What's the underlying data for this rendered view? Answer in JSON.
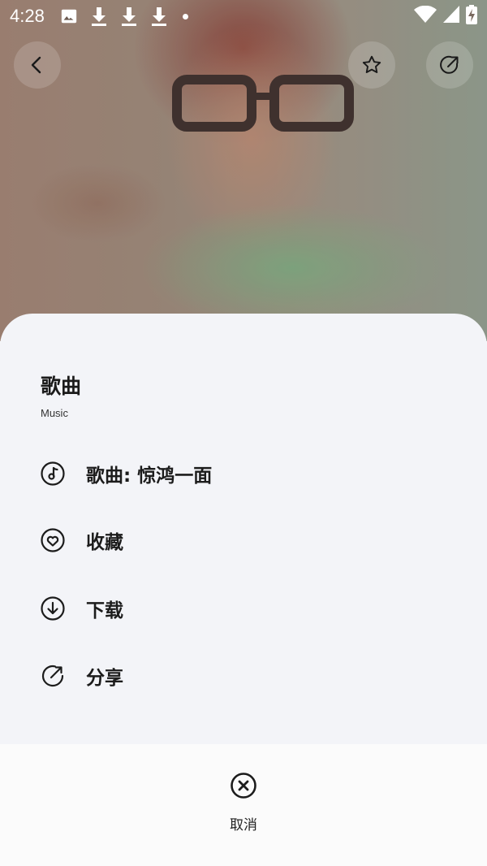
{
  "status_bar": {
    "time": "4:28",
    "icons": [
      "image-icon",
      "download-icon",
      "download-icon",
      "download-icon",
      "dot-icon"
    ],
    "right_icons": [
      "wifi-icon",
      "cell-signal-icon",
      "battery-charging-icon"
    ]
  },
  "header": {
    "back_icon": "chevron-left-icon",
    "favorite_icon": "star-icon",
    "share_icon": "share-icon"
  },
  "sheet": {
    "title": "歌曲",
    "subtitle": "Music",
    "items": [
      {
        "icon": "music-note-icon",
        "label": "歌曲: 惊鸿一面"
      },
      {
        "icon": "heart-icon",
        "label": "收藏"
      },
      {
        "icon": "download-circle-icon",
        "label": "下载"
      },
      {
        "icon": "share-icon",
        "label": "分享"
      }
    ]
  },
  "cancel": {
    "icon": "close-circle-icon",
    "label": "取消"
  },
  "colors": {
    "sheet_background": "#f3f4f8",
    "page_background": "#fbfbfb",
    "text": "#1c1c1c"
  }
}
